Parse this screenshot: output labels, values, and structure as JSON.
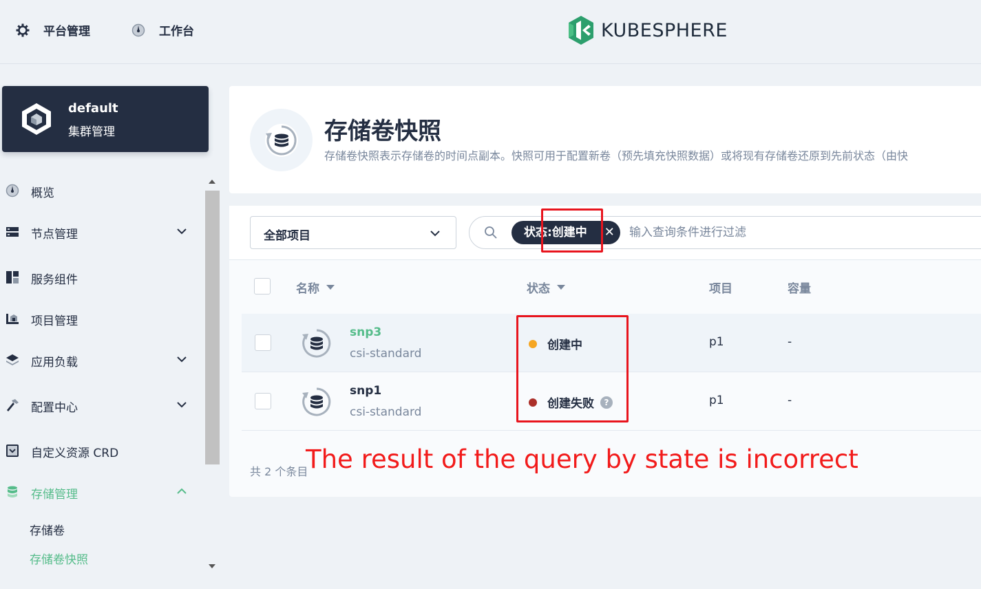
{
  "topbar": {
    "platform_label": "平台管理",
    "workbench_label": "工作台",
    "logo_text": "KUBESPHERE",
    "logo_color": "#2c9f6d"
  },
  "cluster": {
    "name": "default",
    "subtitle": "集群管理"
  },
  "sidebar": {
    "items": [
      {
        "label": "概览",
        "icon": "dashboard-icon"
      },
      {
        "label": "节点管理",
        "icon": "server-icon"
      },
      {
        "label": "服务组件",
        "icon": "components-icon"
      },
      {
        "label": "项目管理",
        "icon": "project-icon"
      },
      {
        "label": "应用负载",
        "icon": "layers-icon"
      },
      {
        "label": "配置中心",
        "icon": "hammer-icon"
      },
      {
        "label": "自定义资源 CRD",
        "icon": "crd-icon"
      },
      {
        "label": "存储管理",
        "icon": "database-icon"
      }
    ],
    "sub_items": [
      {
        "label": "存储卷"
      },
      {
        "label": "存储卷快照"
      }
    ]
  },
  "header": {
    "title": "存储卷快照",
    "description": "存储卷快照表示存储卷的时间点副本。快照可用于配置新卷（预先填充快照数据）或将现有存储卷还原到先前状态（由快"
  },
  "toolbar": {
    "project_select": "全部项目",
    "filter_tag": "状态:创建中",
    "search_placeholder": "输入查询条件进行过滤"
  },
  "table": {
    "columns": {
      "name": "名称",
      "status": "状态",
      "project": "项目",
      "capacity": "容量"
    },
    "rows": [
      {
        "name": "snp3",
        "class": "csi-standard",
        "status": "创建中",
        "status_color": "#f5a623",
        "project": "p1",
        "capacity": "-"
      },
      {
        "name": "snp1",
        "class": "csi-standard",
        "status": "创建失败",
        "status_color": "#ab2f29",
        "project": "p1",
        "capacity": "-",
        "help": "?"
      }
    ],
    "total": "共 2 个条目"
  },
  "annotation": {
    "text": "The result of the query by state is incorrect",
    "color": "#f21b1b"
  }
}
